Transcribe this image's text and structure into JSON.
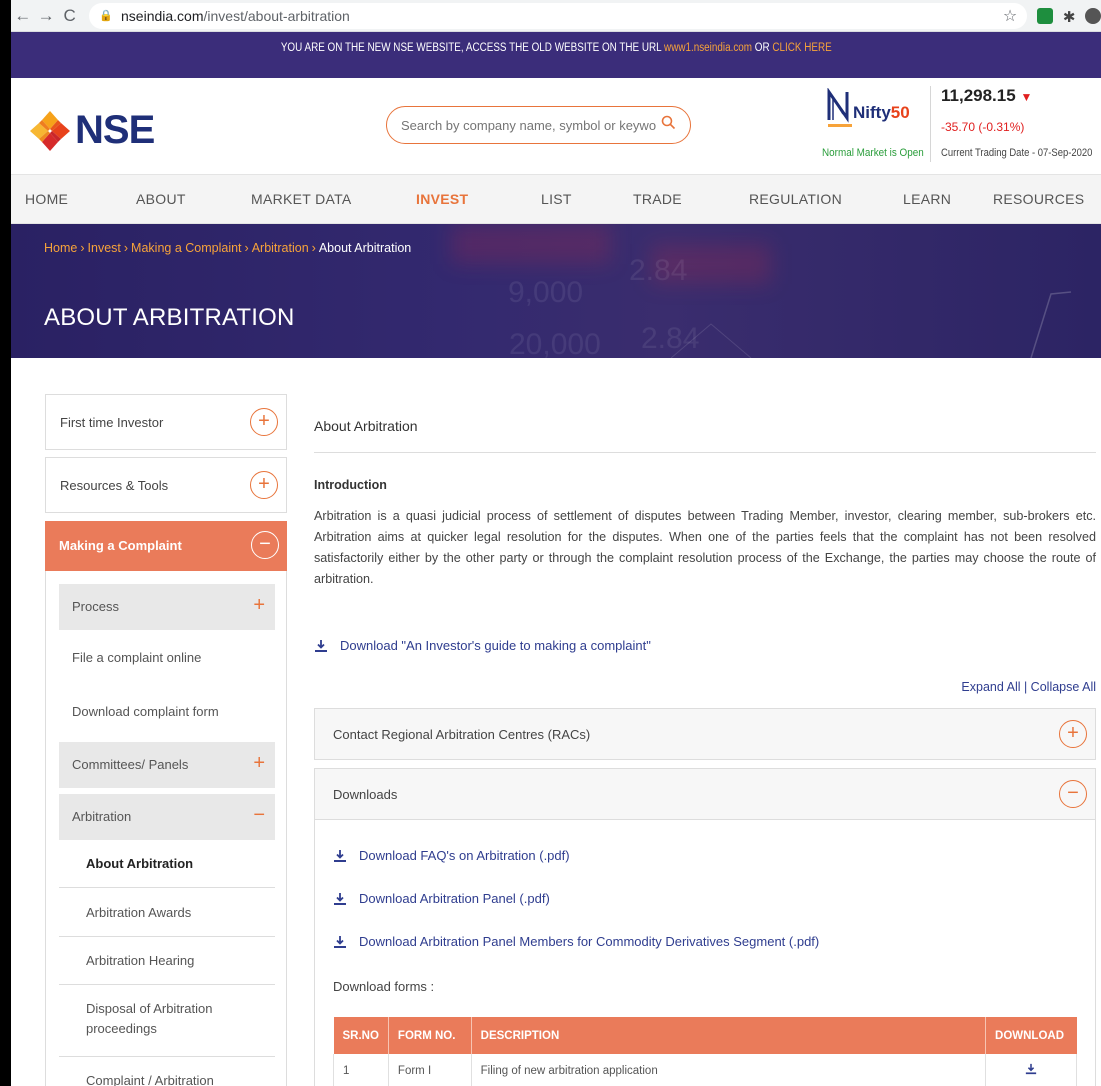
{
  "browser": {
    "url_host": "nseindia.com",
    "url_path": "/invest/about-arbitration"
  },
  "notice": {
    "prefix": "YOU ARE ON THE NEW NSE WEBSITE, ACCESS THE OLD WEBSITE ON THE URL ",
    "old_url": "www1.nseindia.com",
    "middle": " OR ",
    "click_here": "CLICK HERE"
  },
  "header": {
    "logo_text": "NSE",
    "search_placeholder": "Search by company name, symbol or keyword",
    "nifty_prefix": "Nifty",
    "nifty_suffix": "50",
    "market_status": "Normal Market is Open",
    "index_value": "11,298.15",
    "index_change": "-35.70 (-0.31%)",
    "trading_date": "Current Trading Date - 07-Sep-2020"
  },
  "nav": {
    "items": [
      "HOME",
      "ABOUT",
      "MARKET DATA",
      "INVEST",
      "LIST",
      "TRADE",
      "REGULATION",
      "LEARN",
      "RESOURCES"
    ],
    "active": "INVEST"
  },
  "banner": {
    "breadcrumb": [
      "Home",
      "Invest",
      "Making a Complaint",
      "Arbitration"
    ],
    "breadcrumb_sep": "›",
    "breadcrumb_current": "About Arbitration",
    "title": "ABOUT ARBITRATION",
    "bg_numbers": [
      "9,000",
      "2.84",
      "20,000",
      "2.84"
    ]
  },
  "sidebar": {
    "first_time": "First time Investor",
    "resources": "Resources & Tools",
    "complaint": "Making a Complaint",
    "process": "Process",
    "file_online": "File a complaint online",
    "download_form": "Download complaint form",
    "committees": "Committees/ Panels",
    "arbitration": "Arbitration",
    "about": "About Arbitration",
    "awards": "Arbitration Awards",
    "hearing": "Arbitration Hearing",
    "disposal": "Disposal of Arbitration proceedings",
    "complaint_arb": "Complaint / Arbitration",
    "plus": "+",
    "minus": "−"
  },
  "content": {
    "section_title": "About Arbitration",
    "intro_heading": "Introduction",
    "intro_text": "Arbitration is a quasi judicial process of settlement of disputes between Trading Member, investor, clearing member, sub-brokers etc. Arbitration aims at quicker legal resolution for the disputes. When one of the parties feels that the complaint has not been resolved satisfactorily either by the other party or through the complaint resolution process of the Exchange, the parties may choose the route of arbitration.",
    "guide_link": "Download \"An Investor's guide to making a complaint\"",
    "expand_all": "Expand All | Collapse All",
    "acc_rac": "Contact Regional Arbitration Centres (RACs)",
    "acc_downloads": "Downloads",
    "dl_faq": "Download FAQ's on Arbitration (.pdf)",
    "dl_panel": "Download Arbitration Panel (.pdf)",
    "dl_commodity": "Download Arbitration Panel Members for Commodity Derivatives Segment (.pdf)",
    "download_forms": "Download forms :",
    "table": {
      "headers": [
        "SR.NO",
        "FORM NO.",
        "DESCRIPTION",
        "DOWNLOAD"
      ],
      "rows": [
        {
          "sr": "1",
          "form": "Form I",
          "desc": "Filing of new arbitration application"
        }
      ]
    }
  },
  "colors": {
    "brand_navy": "#1f2f78",
    "accent_orange": "#e8743b",
    "active_salmon": "#ea7b5a",
    "banner_purple": "#2a2163",
    "link_blue": "#2f3d8f",
    "down_red": "#e02020",
    "market_green": "#2a9d3b"
  }
}
